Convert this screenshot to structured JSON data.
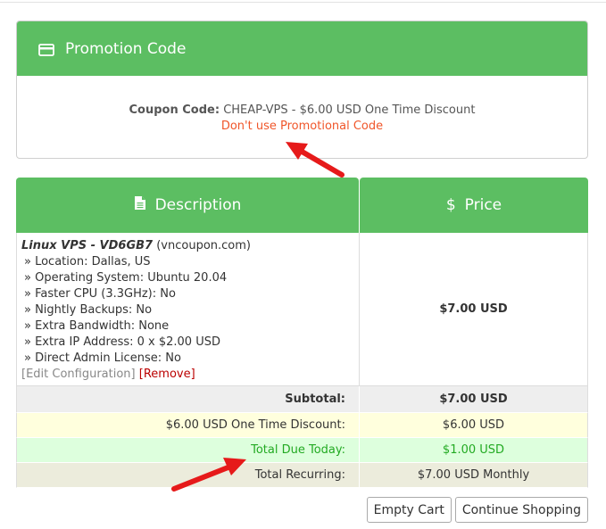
{
  "promo": {
    "title": "Promotion Code",
    "coupon_label": "Coupon Code:",
    "coupon_value": "CHEAP-VPS - $6.00 USD One Time Discount",
    "remove_link": "Don't use Promotional Code",
    "icon": "credit-card-icon"
  },
  "table": {
    "headers": {
      "description": "Description",
      "price": "Price"
    },
    "item": {
      "name": "Linux VPS - VD6GB7",
      "domain": "(vncoupon.com)",
      "options": [
        "» Location: Dallas, US",
        "» Operating System: Ubuntu 20.04",
        "» Faster CPU (3.3GHz): No",
        "» Nightly Backups: No",
        "» Extra Bandwidth: None",
        "» Extra IP Address: 0 x $2.00 USD",
        "» Direct Admin License: No"
      ],
      "edit_label": "[Edit Configuration]",
      "remove_label": "[Remove]",
      "price": "$7.00 USD"
    },
    "subtotal": {
      "label": "Subtotal:",
      "value": "$7.00 USD"
    },
    "discount": {
      "label": "$6.00 USD One Time Discount:",
      "value": "$6.00 USD"
    },
    "total_due": {
      "label": "Total Due Today:",
      "value": "$1.00 USD"
    },
    "recurring": {
      "label": "Total Recurring:",
      "value": "$7.00 USD Monthly"
    }
  },
  "buttons": {
    "empty_cart": "Empty Cart",
    "continue_shopping": "Continue Shopping"
  },
  "colors": {
    "green": "#5cbe62",
    "link_orange": "#f0562a",
    "arrow_red": "#e61a1a"
  }
}
